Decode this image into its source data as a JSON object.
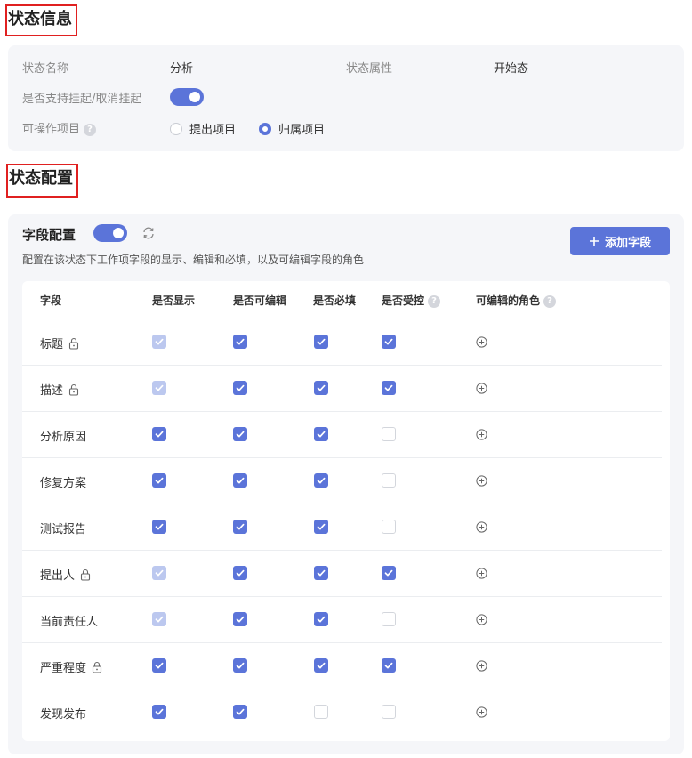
{
  "sections": {
    "info_title": "状态信息",
    "config_title": "状态配置"
  },
  "info": {
    "name_label": "状态名称",
    "name_value": "分析",
    "attr_label": "状态属性",
    "attr_value": "开始态",
    "suspend_label": "是否支持挂起/取消挂起",
    "suspend_enabled": true,
    "operable_label": "可操作项目",
    "operable_options": [
      "提出项目",
      "归属项目"
    ],
    "operable_selected": "归属项目"
  },
  "config": {
    "title": "字段配置",
    "enabled": true,
    "description": "配置在该状态下工作项字段的显示、编辑和必填，以及可编辑字段的角色",
    "add_button": "添加字段",
    "columns": [
      "字段",
      "是否显示",
      "是否可编辑",
      "是否必填",
      "是否受控",
      "可编辑的角色"
    ],
    "rows": [
      {
        "name": "标题",
        "locked": true,
        "show": "disabled",
        "editable": "checked",
        "required": "checked",
        "controlled": "checked"
      },
      {
        "name": "描述",
        "locked": true,
        "show": "disabled",
        "editable": "checked",
        "required": "checked",
        "controlled": "checked"
      },
      {
        "name": "分析原因",
        "locked": false,
        "show": "checked",
        "editable": "checked",
        "required": "checked",
        "controlled": "unchecked"
      },
      {
        "name": "修复方案",
        "locked": false,
        "show": "checked",
        "editable": "checked",
        "required": "checked",
        "controlled": "unchecked"
      },
      {
        "name": "测试报告",
        "locked": false,
        "show": "checked",
        "editable": "checked",
        "required": "checked",
        "controlled": "unchecked"
      },
      {
        "name": "提出人",
        "locked": true,
        "show": "disabled",
        "editable": "checked",
        "required": "checked",
        "controlled": "checked"
      },
      {
        "name": "当前责任人",
        "locked": false,
        "show": "disabled",
        "editable": "checked",
        "required": "checked",
        "controlled": "unchecked"
      },
      {
        "name": "严重程度",
        "locked": true,
        "show": "checked",
        "editable": "checked",
        "required": "checked",
        "controlled": "checked"
      },
      {
        "name": "发现发布",
        "locked": false,
        "show": "checked",
        "editable": "checked",
        "required": "unchecked",
        "controlled": "unchecked"
      }
    ]
  },
  "colors": {
    "accent": "#5b74d9",
    "checkbox_disabled": "#bcc8ef",
    "panel_bg": "#f5f6f9",
    "title_border": "#e02020"
  },
  "icons": {
    "lock": "lock-icon",
    "help": "help-icon",
    "refresh": "refresh-icon",
    "add_role": "plus-circle-icon",
    "add": "plus-icon"
  }
}
